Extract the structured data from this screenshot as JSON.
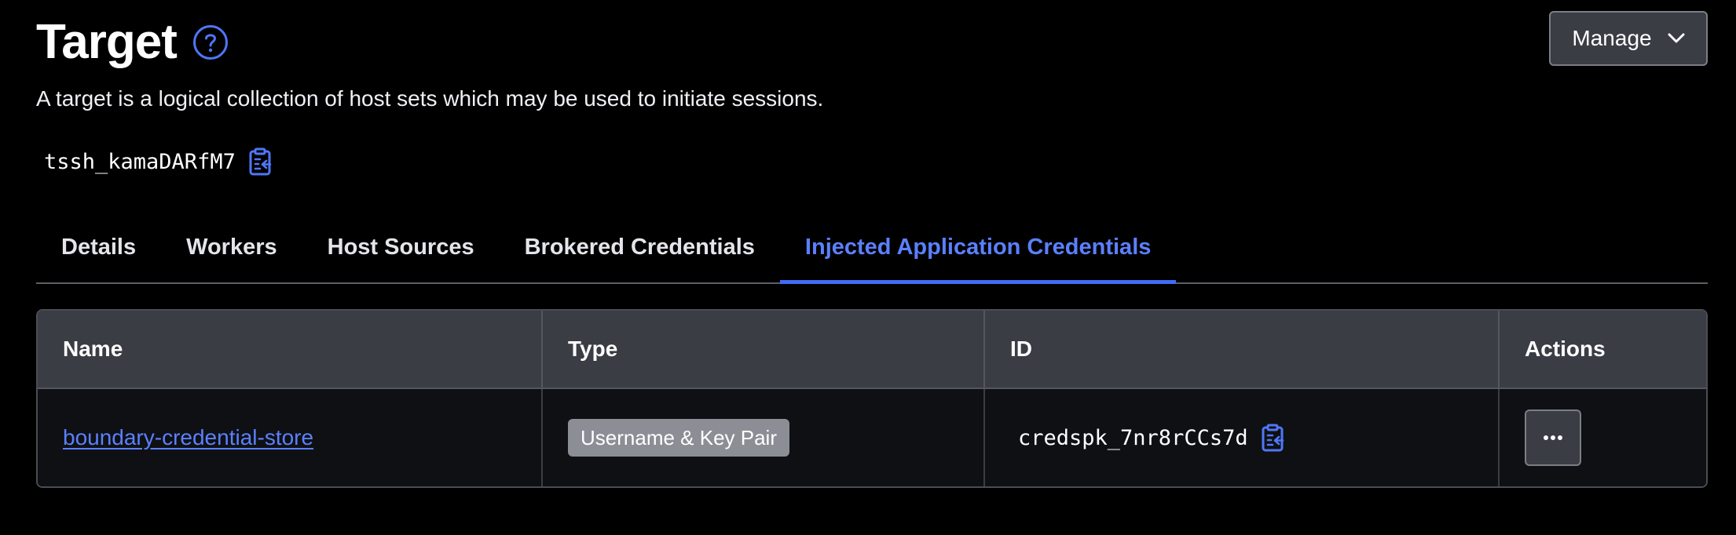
{
  "header": {
    "title": "Target",
    "help_icon": "question-circle-icon",
    "manage_label": "Manage",
    "manage_icon": "chevron-down-icon",
    "description": "A target is a logical collection of host sets which may be used to initiate sessions."
  },
  "target": {
    "id": "tssh_kamaDARfM7",
    "copy_icon": "clipboard-copy-icon"
  },
  "tabs": [
    {
      "label": "Details",
      "active": false
    },
    {
      "label": "Workers",
      "active": false
    },
    {
      "label": "Host Sources",
      "active": false
    },
    {
      "label": "Brokered Credentials",
      "active": false
    },
    {
      "label": "Injected Application Credentials",
      "active": true
    }
  ],
  "table": {
    "columns": [
      "Name",
      "Type",
      "ID",
      "Actions"
    ],
    "rows": [
      {
        "name": "boundary-credential-store",
        "type": "Username & Key Pair",
        "id": "credspk_7nr8rCCs7d",
        "copy_icon": "clipboard-copy-icon",
        "actions_icon": "more-horizontal-icon"
      }
    ]
  },
  "colors": {
    "background": "#000000",
    "accent": "#3f6cf5",
    "link": "#5b80ff",
    "header_bg": "#3b3d45",
    "badge_bg": "#8c8e96"
  }
}
